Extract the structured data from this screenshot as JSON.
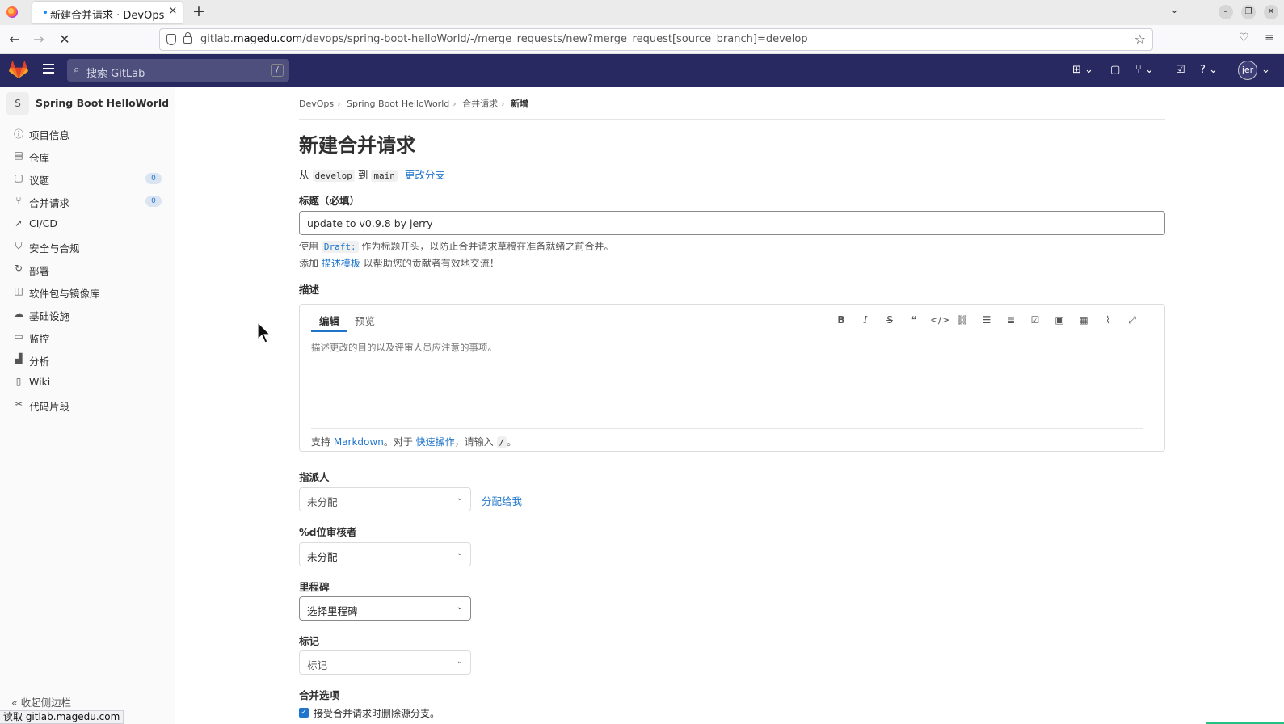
{
  "browser": {
    "tab_title": "新建合并请求 · DevOps / S",
    "tab_close": "×",
    "new_tab": "+",
    "url_prefix": "gitlab.",
    "url_domain": "magedu.com",
    "url_path": "/devops/spring-boot-helloWorld/-/merge_requests/new?merge_request[source_branch]=develop",
    "status_tip": "读取 gitlab.magedu.com"
  },
  "header": {
    "search_placeholder": "搜索 GitLab",
    "search_shortcut": "/",
    "avatar_initials": "jer"
  },
  "sidebar": {
    "project_initial": "S",
    "project_name": "Spring Boot HelloWorld",
    "items": [
      {
        "label": "项目信息",
        "icon": "info-icon"
      },
      {
        "label": "仓库",
        "icon": "document-icon"
      },
      {
        "label": "议题",
        "icon": "issues-icon",
        "badge": "0"
      },
      {
        "label": "合并请求",
        "icon": "merge-request-icon",
        "badge": "0"
      },
      {
        "label": "CI/CD",
        "icon": "rocket-icon"
      },
      {
        "label": "安全与合规",
        "icon": "shield-icon"
      },
      {
        "label": "部署",
        "icon": "deployments-icon"
      },
      {
        "label": "软件包与镜像库",
        "icon": "package-icon"
      },
      {
        "label": "基础设施",
        "icon": "cloud-gear-icon"
      },
      {
        "label": "监控",
        "icon": "monitor-icon"
      },
      {
        "label": "分析",
        "icon": "chart-icon"
      },
      {
        "label": "Wiki",
        "icon": "book-icon"
      },
      {
        "label": "代码片段",
        "icon": "snippet-icon"
      }
    ],
    "collapse_label": "收起侧边栏"
  },
  "main": {
    "breadcrumbs": [
      "DevOps",
      "Spring Boot HelloWorld",
      "合并请求",
      "新增"
    ],
    "title": "新建合并请求",
    "branch_from_word": "从",
    "source_branch": "develop",
    "branch_to_word": "到",
    "target_branch": "main",
    "change_branches": "更改分支",
    "title_label": "标题（必填）",
    "title_value": "update to v0.9.8 by jerry",
    "draft_hint_pre": "使用",
    "draft_keyword": "Draft:",
    "draft_hint_post": "作为标题开头，以防止合并请求草稿在准备就绪之前合并。",
    "template_hint_pre": "添加",
    "template_link": "描述模板",
    "template_hint_post": "以帮助您的贡献者有效地交流！",
    "description_label": "描述",
    "tab_edit": "编辑",
    "tab_preview": "预览",
    "description_placeholder": "描述更改的目的以及评审人员应注意的事项。",
    "md_support_pre": "支持",
    "md_link": "Markdown",
    "md_mid": "。对于",
    "quick_actions_link": "快速操作",
    "md_post": "，请输入",
    "md_slash": "/",
    "md_end": "。",
    "assignee_label": "指派人",
    "assignee_value": "未分配",
    "assign_to_me": "分配给我",
    "reviewer_label": "%d位审核者",
    "reviewer_value": "未分配",
    "milestone_label": "里程碑",
    "milestone_value": "选择里程碑",
    "labels_label": "标记",
    "labels_value": "标记",
    "merge_options_label": "合并选项",
    "delete_source_branch": "接受合并请求时删除源分支。"
  },
  "colors": {
    "gitlab_header": "#292961",
    "link": "#1f75cb",
    "badge_bg": "#dbe5f2"
  }
}
